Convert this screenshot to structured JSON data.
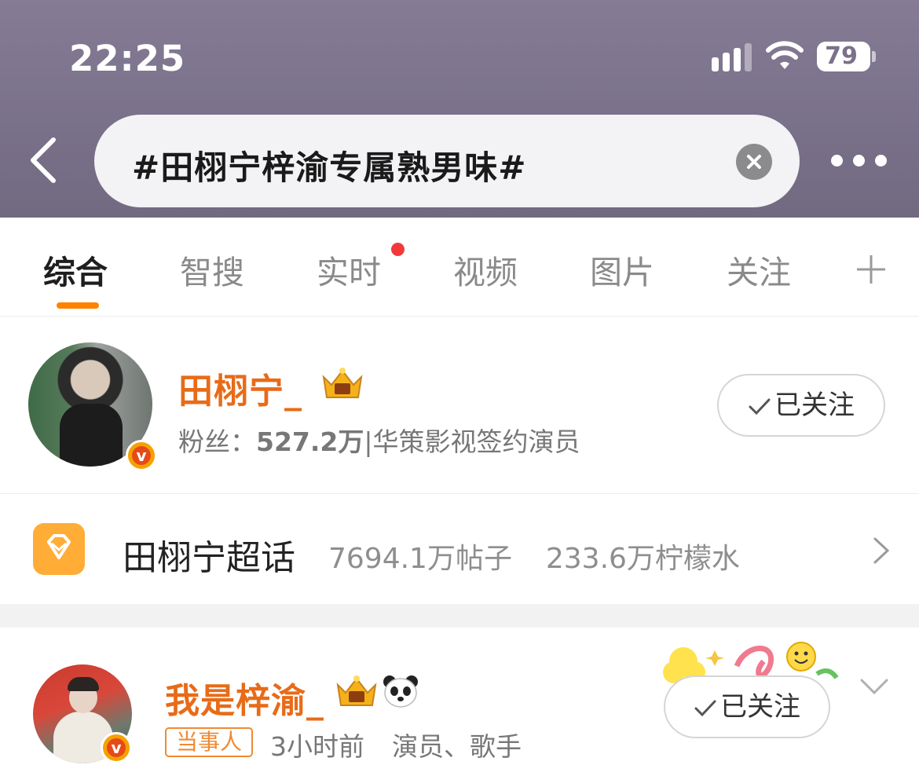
{
  "status_bar": {
    "time": "22:25",
    "battery": "79"
  },
  "search": {
    "query": "#田栩宁梓渝专属熟男味#"
  },
  "tabs": [
    {
      "label": "综合"
    },
    {
      "label": "智搜"
    },
    {
      "label": "实时"
    },
    {
      "label": "视频"
    },
    {
      "label": "图片"
    },
    {
      "label": "关注"
    }
  ],
  "user_card": {
    "name": "田栩宁_",
    "fans_label": "粉丝：",
    "fans_count": "527.2万",
    "description": "|华策影视签约演员",
    "follow_label": "已关注"
  },
  "super_topic": {
    "name": "田栩宁超话",
    "posts": "7694.1万帖子",
    "members": "233.6万柠檬水"
  },
  "post": {
    "author": "我是梓渝_",
    "badge": "当事人",
    "time": "3小时前",
    "roles": "演员、歌手",
    "follow_label": "已关注"
  },
  "colors": {
    "accent": "#ff8200",
    "username": "#e86b18",
    "red_dot": "#f23a3a"
  },
  "icons": [
    "back-icon",
    "clear-icon",
    "more-icon",
    "plus-icon",
    "verified-icon",
    "crown-icon",
    "panda-icon",
    "supertopic-icon",
    "chevron-right-icon",
    "chevron-down-icon"
  ]
}
